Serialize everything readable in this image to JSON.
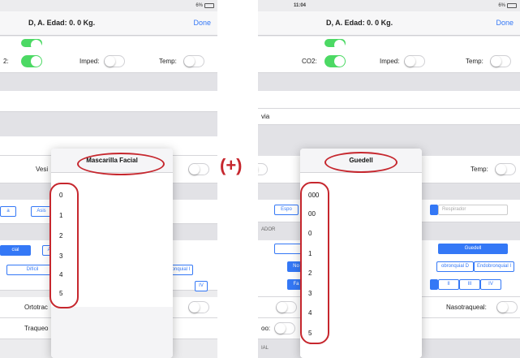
{
  "left": {
    "status": {
      "battery": "6%"
    },
    "nav": {
      "title": "D, A. Edad: 0. 0 Kg.",
      "done": "Done"
    },
    "rows": {
      "co2_partial": "2:",
      "imped": "Imped:",
      "temp": "Temp:",
      "vesi": "Vesi",
      "ortotrac": "Ortotrac",
      "traqueo": "Traqueo"
    },
    "segments": {
      "s1": "a",
      "s2": "Asis",
      "s3": "cial",
      "s4": "Anilad",
      "s5": "Difícil",
      "s6": "onquial I",
      "s7": "IV"
    },
    "popover": {
      "title": "Mascarilla Facial",
      "items": [
        "0",
        "1",
        "2",
        "3",
        "4",
        "5"
      ]
    }
  },
  "right": {
    "status": {
      "time": "11:04",
      "battery": "6%"
    },
    "nav": {
      "title": "D, A. Edad: 0. 0 Kg.",
      "done": "Done"
    },
    "rows": {
      "co2": "CO2:",
      "imped": "Imped:",
      "temp": "Temp:",
      "via": "via",
      "temp2": "Temp:",
      "nasotraqueal": "Nasotraqueal:",
      "oo": "oo:",
      "ador": "ADOR",
      "ial": "IAL"
    },
    "segments": {
      "espo": "Espo",
      "respirador": "Respirador",
      "guedell": "Guedell",
      "no": "No",
      "endo_d": "obronquial D",
      "endo_i": "Endobronquial I",
      "fa": "Fa",
      "ii": "II",
      "iii": "III",
      "iv": "IV"
    },
    "popover": {
      "title": "Guedell",
      "items": [
        "000",
        "00",
        "0",
        "1",
        "2",
        "3",
        "4",
        "5"
      ]
    }
  },
  "plus": "(+)",
  "colors": {
    "annotation": "#c6272e",
    "toggle_on": "#4cd964",
    "ios_blue": "#3478f6"
  }
}
